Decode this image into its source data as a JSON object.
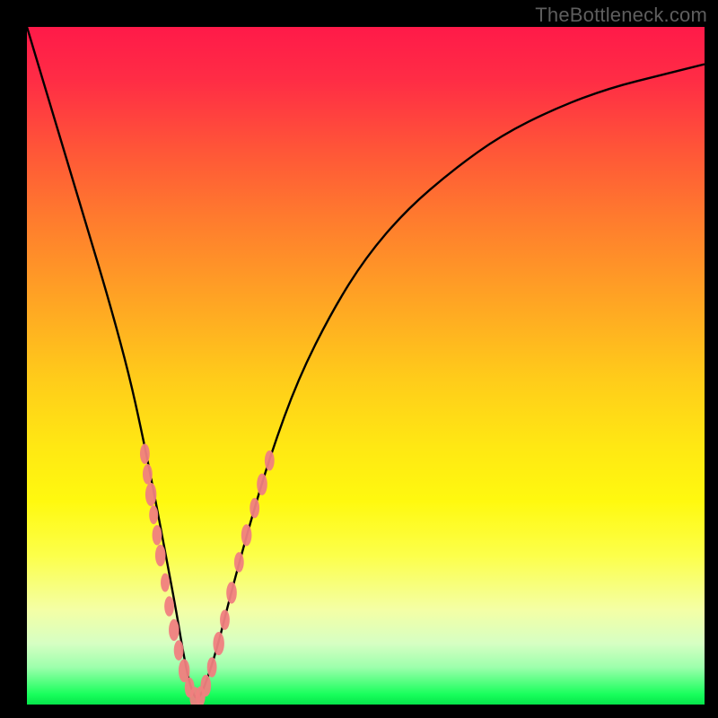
{
  "watermark": "TheBottleneck.com",
  "colors": {
    "frame": "#000000",
    "curve": "#000000",
    "dot": "#f08080"
  },
  "chart_data": {
    "type": "line",
    "title": "",
    "xlabel": "",
    "ylabel": "",
    "xlim": [
      0,
      100
    ],
    "ylim": [
      0,
      100
    ],
    "grid": false,
    "series": [
      {
        "name": "bottleneck-curve",
        "x": [
          0,
          3,
          6,
          9,
          12,
          15,
          17,
          19,
          20.5,
          22,
          23,
          24,
          25,
          26,
          28,
          30,
          33,
          36,
          40,
          45,
          50,
          56,
          63,
          70,
          78,
          86,
          94,
          100
        ],
        "y": [
          100,
          90,
          80,
          70,
          60,
          49,
          40,
          30,
          22,
          14,
          8,
          3,
          0.5,
          2,
          8,
          16,
          27,
          37,
          48,
          58,
          66,
          73,
          79,
          84,
          88,
          91,
          93,
          94.5
        ]
      }
    ],
    "scatter": {
      "name": "sample-points",
      "points": [
        {
          "x": 17.4,
          "y": 37,
          "r": 1.3
        },
        {
          "x": 17.8,
          "y": 34,
          "r": 1.3
        },
        {
          "x": 18.3,
          "y": 31,
          "r": 1.5
        },
        {
          "x": 18.7,
          "y": 28,
          "r": 1.2
        },
        {
          "x": 19.2,
          "y": 25,
          "r": 1.3
        },
        {
          "x": 19.7,
          "y": 22,
          "r": 1.4
        },
        {
          "x": 20.4,
          "y": 18,
          "r": 1.2
        },
        {
          "x": 21.0,
          "y": 14.5,
          "r": 1.3
        },
        {
          "x": 21.7,
          "y": 11,
          "r": 1.4
        },
        {
          "x": 22.4,
          "y": 8,
          "r": 1.3
        },
        {
          "x": 23.2,
          "y": 5,
          "r": 1.5
        },
        {
          "x": 24.0,
          "y": 2.5,
          "r": 1.3
        },
        {
          "x": 24.8,
          "y": 1.0,
          "r": 1.4
        },
        {
          "x": 25.6,
          "y": 1.2,
          "r": 1.3
        },
        {
          "x": 26.4,
          "y": 2.8,
          "r": 1.4
        },
        {
          "x": 27.3,
          "y": 5.5,
          "r": 1.3
        },
        {
          "x": 28.3,
          "y": 9,
          "r": 1.5
        },
        {
          "x": 29.2,
          "y": 12.5,
          "r": 1.3
        },
        {
          "x": 30.2,
          "y": 16.5,
          "r": 1.4
        },
        {
          "x": 31.3,
          "y": 21,
          "r": 1.3
        },
        {
          "x": 32.4,
          "y": 25,
          "r": 1.4
        },
        {
          "x": 33.6,
          "y": 29,
          "r": 1.3
        },
        {
          "x": 34.7,
          "y": 32.5,
          "r": 1.4
        },
        {
          "x": 35.8,
          "y": 36,
          "r": 1.3
        }
      ]
    }
  }
}
